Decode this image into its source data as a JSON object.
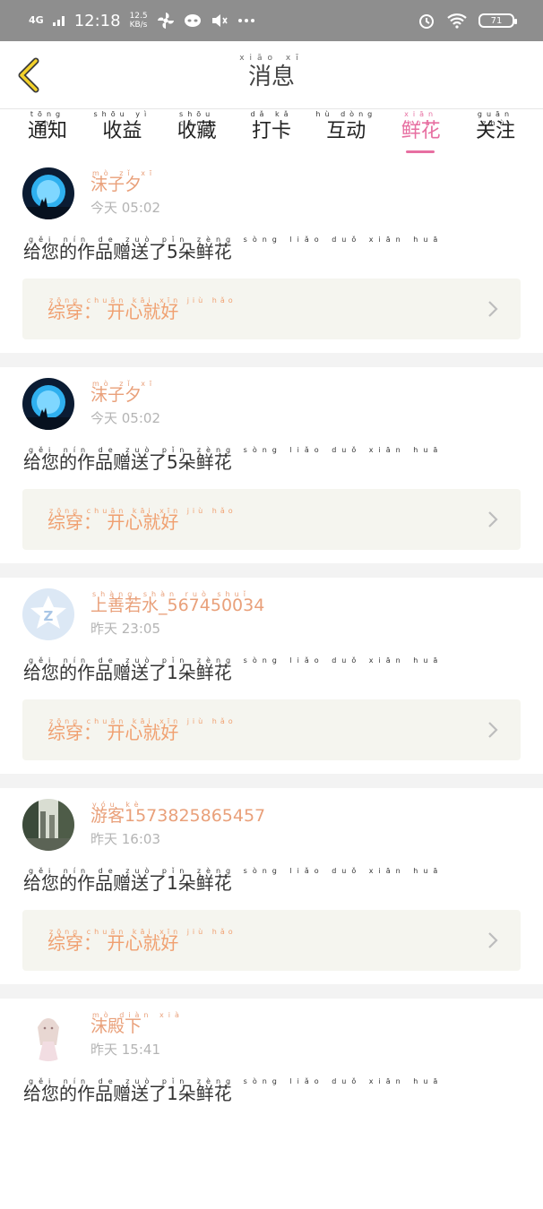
{
  "status_bar": {
    "network": "4G",
    "time": "12:18",
    "speed_value": "12.5",
    "speed_unit": "KB/s",
    "battery": "71"
  },
  "header": {
    "title_pinyin": "xiāo xī",
    "title": "消息"
  },
  "tabs": [
    {
      "pinyin": "tōng zhī",
      "label": "通知",
      "active": false
    },
    {
      "pinyin": "shōu yì",
      "label": "收益",
      "active": false
    },
    {
      "pinyin": "shōu cáng",
      "label": "收藏",
      "active": false
    },
    {
      "pinyin": "dǎ kǎ",
      "label": "打卡",
      "active": false
    },
    {
      "pinyin": "hù dòng",
      "label": "互动",
      "active": false
    },
    {
      "pinyin": "xiān huā",
      "label": "鲜花",
      "active": true
    },
    {
      "pinyin": "guān zhù",
      "label": "关注",
      "active": false
    }
  ],
  "messages": [
    {
      "avatar": "moon-silhouette-avatar",
      "user_pinyin": "mò zǐ xī",
      "user": "沫子夕",
      "time": "今天 05:02",
      "message_pinyin": "gěi nín de zuò pǐn zèng sòng liǎo duǒ xiān huā",
      "message": "给您的作品赠送了5朵鲜花",
      "work_pinyin": "zōng chuān kāi xīn jiù hǎo",
      "work": "综穿：  开心就好"
    },
    {
      "avatar": "moon-silhouette-avatar",
      "user_pinyin": "mò zǐ xī",
      "user": "沫子夕",
      "time": "今天 05:02",
      "message_pinyin": "gěi nín de zuò pǐn zèng sòng liǎo duǒ xiān huā",
      "message": "给您的作品赠送了5朵鲜花",
      "work_pinyin": "zōng chuān kāi xīn jiù hǎo",
      "work": "综穿：  开心就好"
    },
    {
      "avatar": "qq-default-avatar",
      "user_pinyin": "shàng shàn ruò shuǐ",
      "user": "上善若水_567450034",
      "time": "昨天 23:05",
      "message_pinyin": "gěi nín de zuò pǐn zèng sòng liǎo duǒ xiān huā",
      "message": "给您的作品赠送了1朵鲜花",
      "work_pinyin": "zōng chuān kāi xīn jiù hǎo",
      "work": "综穿：  开心就好"
    },
    {
      "avatar": "landscape-photo-avatar",
      "user_pinyin": "yóu kè",
      "user": "游客15738258654​57",
      "time": "昨天 16:03",
      "message_pinyin": "gěi nín de zuò pǐn zèng sòng liǎo duǒ xiān huā",
      "message": "给您的作品赠送了1朵鲜花",
      "work_pinyin": "zōng chuān kāi xīn jiù hǎo",
      "work": "综穿：  开心就好"
    },
    {
      "avatar": "anime-girl-avatar",
      "user_pinyin": "mò diàn xià",
      "user": "沫殿下",
      "time": "昨天 15:41",
      "message_pinyin": "gěi nín de zuò pǐn zèng sòng liǎo duǒ xiān huā",
      "message": "给您的作品赠送了1朵鲜花",
      "work_pinyin": "",
      "work": ""
    }
  ]
}
